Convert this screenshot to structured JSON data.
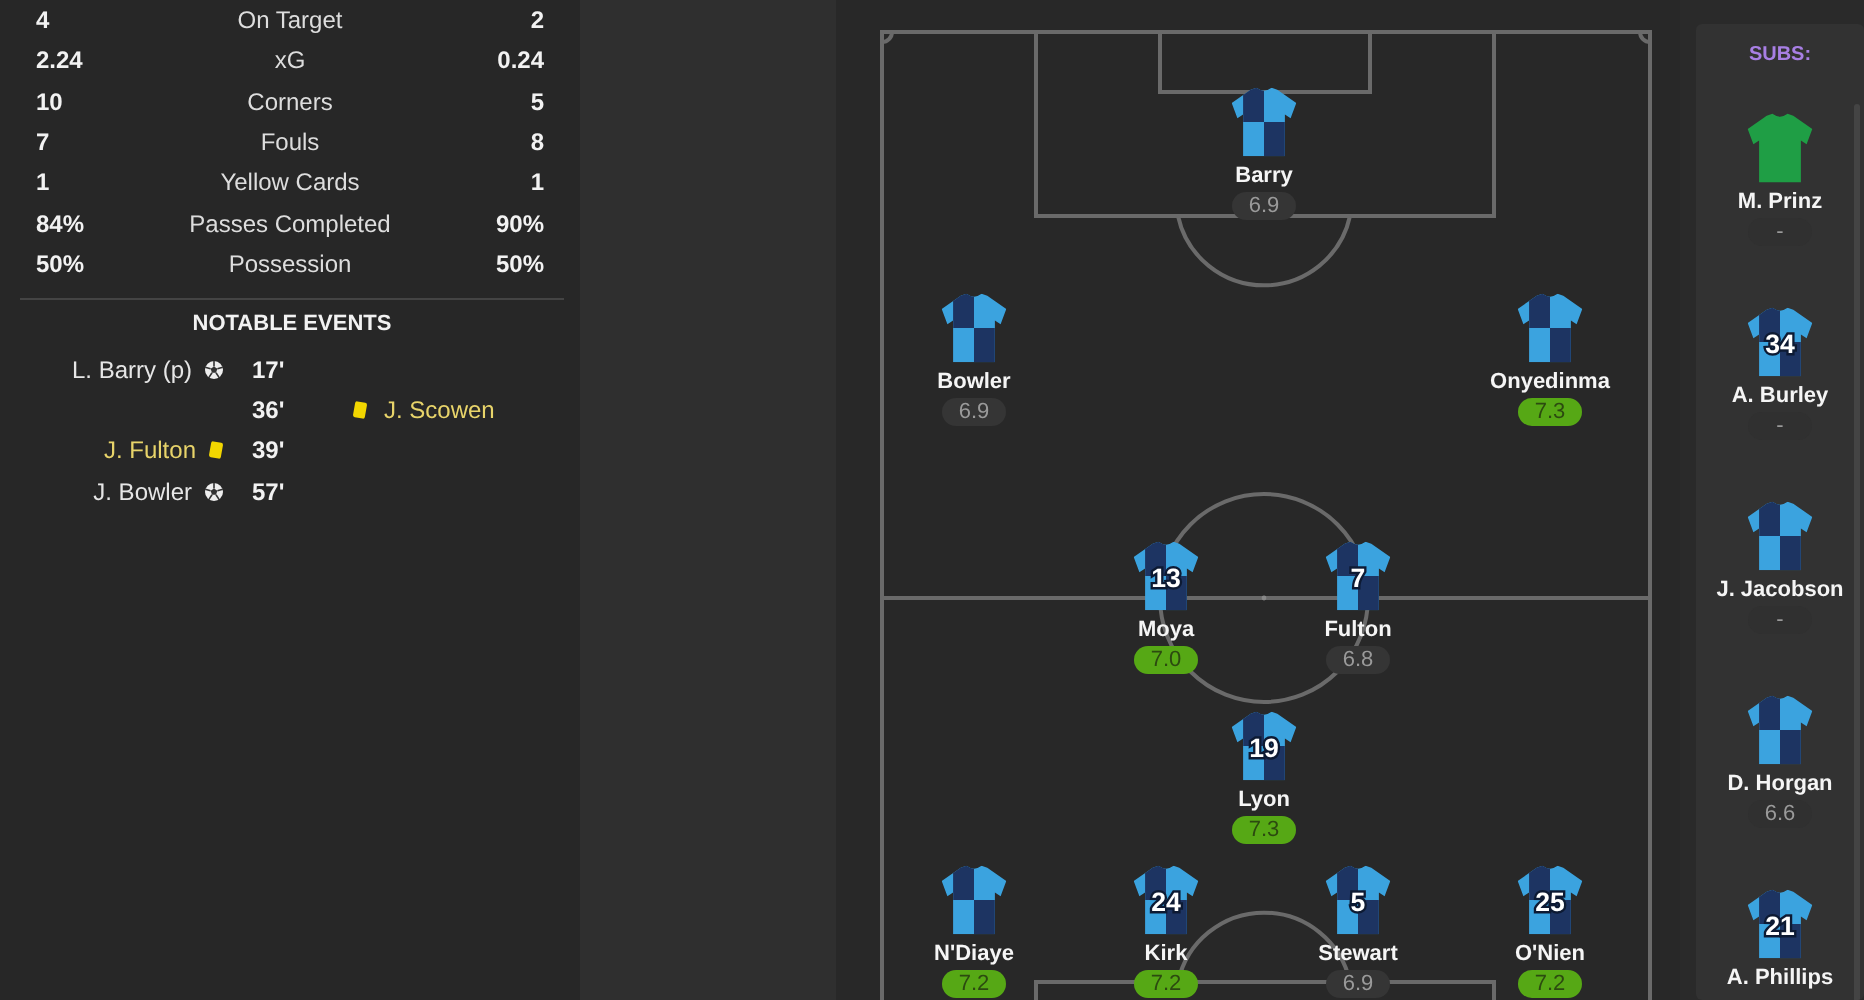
{
  "stats": [
    {
      "home": "4",
      "label": "On Target",
      "away": "2"
    },
    {
      "home": "2.24",
      "label": "xG",
      "away": "0.24"
    },
    {
      "home": "10",
      "label": "Corners",
      "away": "5"
    },
    {
      "home": "7",
      "label": "Fouls",
      "away": "8"
    },
    {
      "home": "1",
      "label": "Yellow Cards",
      "away": "1"
    },
    {
      "home": "84%",
      "label": "Passes Completed",
      "away": "90%"
    },
    {
      "home": "50%",
      "label": "Possession",
      "away": "50%"
    }
  ],
  "events_title": "NOTABLE EVENTS",
  "events": [
    {
      "minute": "17'",
      "home": {
        "kind": "goal",
        "player": "L. Barry (p)"
      }
    },
    {
      "minute": "36'",
      "away": {
        "kind": "yellow",
        "player": "J. Scowen"
      }
    },
    {
      "minute": "39'",
      "home": {
        "kind": "yellow",
        "player": "J. Fulton"
      }
    },
    {
      "minute": "57'",
      "home": {
        "kind": "goal",
        "player": "J. Bowler"
      }
    }
  ],
  "pitch": {
    "players": [
      {
        "name": "Barry",
        "kind": "outfield",
        "rating": "6.9",
        "color": "#353535"
      },
      {
        "name": "Bowler",
        "kind": "outfield",
        "rating": "6.9",
        "color": "#353535"
      },
      {
        "name": "Onyedinma",
        "kind": "outfield",
        "rating": "7.3",
        "color": "#56a815"
      },
      {
        "name": "Moya",
        "kind": "outfield",
        "number": "13",
        "rating": "7.0",
        "color": "#56a815"
      },
      {
        "name": "Fulton",
        "kind": "outfield",
        "number": "7",
        "rating": "6.8",
        "color": "#353535"
      },
      {
        "name": "Lyon",
        "kind": "outfield",
        "number": "19",
        "rating": "7.3",
        "color": "#56a815"
      },
      {
        "name": "N'Diaye",
        "kind": "outfield",
        "rating": "7.2",
        "color": "#56a815"
      },
      {
        "name": "Kirk",
        "kind": "outfield",
        "number": "24",
        "rating": "7.2",
        "color": "#56a815"
      },
      {
        "name": "Stewart",
        "kind": "outfield",
        "number": "5",
        "rating": "6.9",
        "color": "#353535"
      },
      {
        "name": "O'Nien",
        "kind": "outfield",
        "number": "25",
        "rating": "7.2",
        "color": "#56a815"
      }
    ]
  },
  "subs": {
    "title": "SUBS:",
    "players": [
      {
        "name": "M. Prinz",
        "kind": "keeper",
        "rating": "-",
        "color": "#303030"
      },
      {
        "name": "A. Burley",
        "kind": "outfield",
        "number": "34",
        "rating": "-",
        "color": "#303030"
      },
      {
        "name": "J. Jacobson",
        "kind": "outfield",
        "rating": "-",
        "color": "#303030"
      },
      {
        "name": "D. Horgan",
        "kind": "outfield",
        "rating": "6.6",
        "color": "#303030"
      },
      {
        "name": "A. Phillips",
        "kind": "outfield",
        "number": "21"
      }
    ]
  }
}
